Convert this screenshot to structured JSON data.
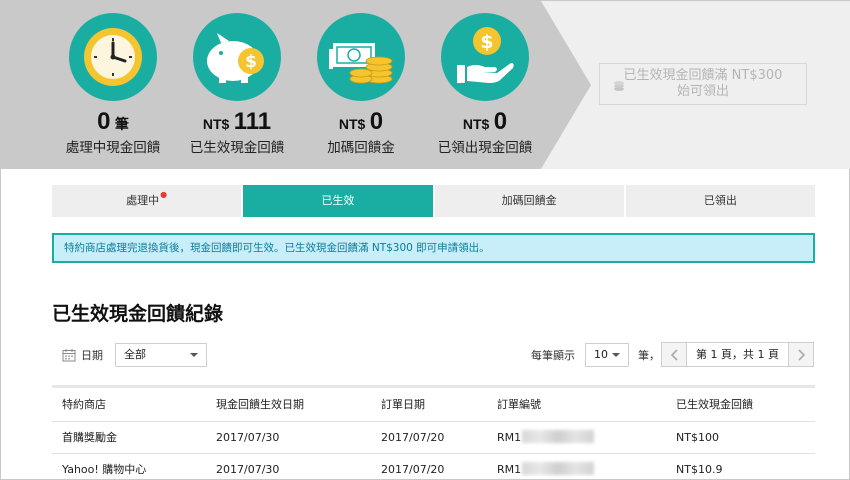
{
  "stats": [
    {
      "icon": "clock-icon",
      "unit": "",
      "value": "0",
      "suffix": "筆",
      "label": "處理中現金回饋"
    },
    {
      "icon": "piggy-bank-icon",
      "unit": "NT$",
      "value": "111",
      "suffix": "",
      "label": "已生效現金回饋"
    },
    {
      "icon": "cash-coins-icon",
      "unit": "NT$",
      "value": "0",
      "suffix": "",
      "label": "加碼回饋金"
    },
    {
      "icon": "hand-coin-icon",
      "unit": "NT$",
      "value": "0",
      "suffix": "",
      "label": "已領出現金回饋"
    }
  ],
  "claim": {
    "line1": "已生效現金回饋滿 NT$300",
    "line2": "始可領出"
  },
  "tabs": [
    {
      "label": "處理中",
      "badge": "●"
    },
    {
      "label": "已生效"
    },
    {
      "label": "加碼回饋金"
    },
    {
      "label": "已領出"
    }
  ],
  "notice": "特約商店處理完退換貨後，現金回饋即可生效。已生效現金回饋滿 NT$300 即可申請領出。",
  "section_title": "已生效現金回饋紀錄",
  "filter": {
    "label": "日期",
    "selected": "全部"
  },
  "pager": {
    "per_page_label": "每筆顯示",
    "per_page": "10",
    "unit": "筆，",
    "page_info": "第 1 頁，共 1 頁"
  },
  "table": {
    "headers": [
      "特約商店",
      "現金回饋生效日期",
      "訂單日期",
      "訂單編號",
      "已生效現金回饋"
    ],
    "rows": [
      [
        "首購獎勵金",
        "2017/07/30",
        "2017/07/20",
        "RM1",
        "NT$100"
      ],
      [
        "Yahoo! 購物中心",
        "2017/07/30",
        "2017/07/20",
        "RM1",
        "NT$10.9"
      ]
    ]
  },
  "colors": {
    "accent": "#1aaea3",
    "notice_bg": "#c7eef9",
    "notice_text": "#0d7d9c",
    "header_band": "#c9c9c9"
  }
}
